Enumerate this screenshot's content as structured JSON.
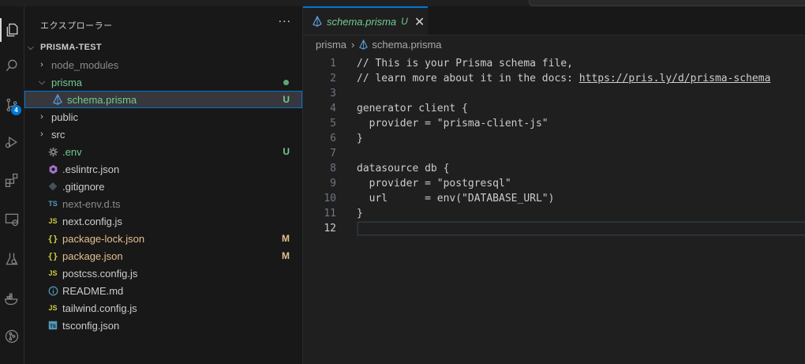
{
  "explorer": {
    "title": "エクスプローラー",
    "more": "···",
    "project": "PRISMA-TEST",
    "items": [
      {
        "label": "node_modules",
        "type": "folder",
        "open": false,
        "indent": 1,
        "color": "#8b8b8b",
        "deco": ""
      },
      {
        "label": "prisma",
        "type": "folder",
        "open": true,
        "indent": 1,
        "color": "#73c991",
        "deco": "dot"
      },
      {
        "label": "schema.prisma",
        "type": "prisma",
        "indent": 2,
        "color": "#73c991",
        "deco": "U",
        "selected": true
      },
      {
        "label": "public",
        "type": "folder",
        "open": false,
        "indent": 1,
        "color": "#cccccc",
        "deco": ""
      },
      {
        "label": "src",
        "type": "folder",
        "open": false,
        "indent": 1,
        "color": "#cccccc",
        "deco": ""
      },
      {
        "label": ".env",
        "type": "gear",
        "indent": 1,
        "color": "#73c991",
        "deco": "U"
      },
      {
        "label": ".eslintrc.json",
        "type": "eslint",
        "indent": 1,
        "color": "#cccccc",
        "deco": ""
      },
      {
        "label": ".gitignore",
        "type": "git",
        "indent": 1,
        "color": "#cccccc",
        "deco": ""
      },
      {
        "label": "next-env.d.ts",
        "type": "ts",
        "indent": 1,
        "color": "#8b8b8b",
        "deco": ""
      },
      {
        "label": "next.config.js",
        "type": "js",
        "indent": 1,
        "color": "#cccccc",
        "deco": ""
      },
      {
        "label": "package-lock.json",
        "type": "json",
        "indent": 1,
        "color": "#e2c08d",
        "deco": "M"
      },
      {
        "label": "package.json",
        "type": "json",
        "indent": 1,
        "color": "#e2c08d",
        "deco": "M"
      },
      {
        "label": "postcss.config.js",
        "type": "js",
        "indent": 1,
        "color": "#cccccc",
        "deco": ""
      },
      {
        "label": "README.md",
        "type": "info",
        "indent": 1,
        "color": "#cccccc",
        "deco": ""
      },
      {
        "label": "tailwind.config.js",
        "type": "js",
        "indent": 1,
        "color": "#cccccc",
        "deco": ""
      },
      {
        "label": "tsconfig.json",
        "type": "tsconfig",
        "indent": 1,
        "color": "#cccccc",
        "deco": ""
      }
    ]
  },
  "tab": {
    "name": "schema.prisma",
    "status": "U",
    "close": "✕"
  },
  "breadcrumb": {
    "folder": "prisma",
    "file": "schema.prisma"
  },
  "activity": {
    "scm_badge": "4"
  },
  "editor": {
    "current_line": 12,
    "lines": [
      {
        "n": "1",
        "text": "// This is your Prisma schema file,"
      },
      {
        "n": "2",
        "text": "// learn more about it in the docs: ",
        "link": "https://pris.ly/d/prisma-schema"
      },
      {
        "n": "3",
        "text": ""
      },
      {
        "n": "4",
        "text": "generator client {"
      },
      {
        "n": "5",
        "text": "  provider = \"prisma-client-js\""
      },
      {
        "n": "6",
        "text": "}"
      },
      {
        "n": "7",
        "text": ""
      },
      {
        "n": "8",
        "text": "datasource db {"
      },
      {
        "n": "9",
        "text": "  provider = \"postgresql\""
      },
      {
        "n": "10",
        "text": "  url      = env(\"DATABASE_URL\")"
      },
      {
        "n": "11",
        "text": "}"
      },
      {
        "n": "12",
        "text": ""
      }
    ]
  },
  "colors": {
    "accent": "#0078d4",
    "untracked": "#73c991",
    "modified": "#e2c08d"
  }
}
